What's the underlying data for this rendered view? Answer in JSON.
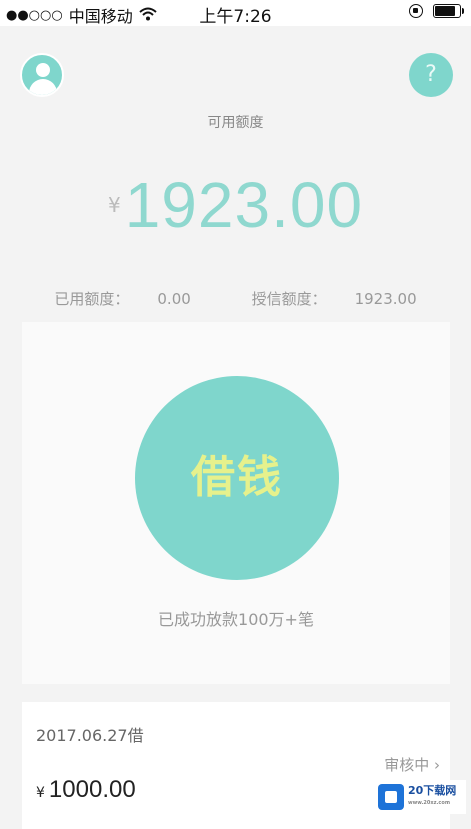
{
  "status_bar": {
    "signal": "●●○○○",
    "carrier": "中国移动",
    "time": "上午7:26"
  },
  "header": {
    "available_label": "可用额度",
    "currency_symbol": "¥",
    "available_amount": "1923.00",
    "used_label": "已用额度：",
    "used_value": "0.00",
    "credit_label": "授信额度：",
    "credit_value": "1923.00"
  },
  "borrow": {
    "button_label": "借钱",
    "success_text": "已成功放款100万+笔"
  },
  "record": {
    "date": "2017.06.27借",
    "status": "审核中 ›",
    "currency_symbol": "¥",
    "amount": "1000.00"
  },
  "watermark": {
    "text": "20下载网",
    "sub": "www.20xz.com"
  },
  "colors": {
    "accent": "#7fd6cc",
    "button_text": "#e6f18c"
  }
}
